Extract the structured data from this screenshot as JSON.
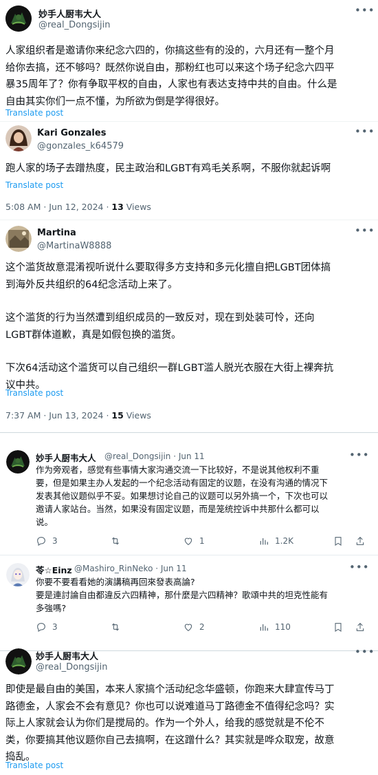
{
  "post1": {
    "name": "妙手人厨韦大人",
    "handle": "@real_Dongsijin",
    "lines": [
      "人家组织者是邀请你来纪念六四的，你搞这些有的没的，六月还有一整个月",
      "给你去搞，还不够吗？既然你说自由，那粉红也可以来这个场子纪念六四平",
      "暴35周年了？你有争取平权的自由，人家也有表达支持中共的自由。什么是",
      "自由其实你们一点不懂，为所欲为倒是学得很好。"
    ],
    "translate": "Translate post"
  },
  "post2": {
    "name": "Kari Gonzales",
    "handle": "@gonzales_k64579",
    "lines": [
      "跑人家的场子去蹭热度，民主政治和LGBT有鸡毛关系啊，不服你就起诉啊"
    ],
    "translate": "Translate post",
    "time": "5:08 AM · Jun 12, 2024 · ",
    "views_count": "13",
    "views_label": " Views"
  },
  "post3": {
    "name": "Martina",
    "handle": "@MartinaW8888",
    "para1": [
      "这个滥货故意混淆视听说什么要取得多方支持和多元化擅自把LGBT团体搞",
      "到海外反共组织的64纪念活动上来了。"
    ],
    "para2": [
      "这个滥货的行为当然遭到组织成员的一致反对，现在到处装可怜，还向",
      "LGBT群体道歉，真是如假包换的滥货。"
    ],
    "para3": [
      "下次64活动这个滥货可以自己组织一群LGBT滥人脱光衣服在大街上裸奔抗",
      "议中共。"
    ],
    "translate": "Translate post",
    "time": "7:37 AM · Jun 13, 2024 · ",
    "views_count": "15",
    "views_label": " Views"
  },
  "reply1": {
    "name": "妙手人厨韦大人",
    "handle_date": "@real_Dongsijin · Jun 11",
    "lines": [
      "作为旁观者，感觉有些事情大家沟通交流一下比较好，不是说其他权利不重",
      "要，但是如果主办人发起的一个纪念活动有固定的议题，在没有沟通的情况下",
      "发表其他议题似乎不妥。如果想讨论自己的议题可以另外搞一个，下次也可以",
      "邀请人家站台。当然，如果没有固定议题，而是笼统控诉中共那什么都可以",
      "说。"
    ],
    "replies": "3",
    "retweets": "",
    "likes": "1",
    "views": "1.2K"
  },
  "reply2": {
    "name": "苓☆Einz",
    "handle_date": "@Mashiro_RinNeko · Jun 11",
    "lines": [
      "你要不要看看她的演講稿再回來發表高論?",
      "要是連討論自由都違反六四精神，那什麼是六四精神？歌頌中共的坦克性能有",
      "多強嗎?"
    ],
    "replies": "3",
    "retweets": "",
    "likes": "2",
    "views": "110"
  },
  "post4": {
    "name": "妙手人厨韦大人",
    "handle": "@real_Dongsijin",
    "lines": [
      "即使是最自由的美国，本来人家搞个活动纪念华盛顿，你跑来大肆宣传马丁",
      "路德金，人家会不会有意见？你也可以说难道马丁路德金不值得纪念吗？实",
      "际上人家就会认为你们是搅局的。作为一个外人，给我的感觉就是不伦不",
      "类，你要搞其他议题你自己去搞啊，在这蹭什么？其实就是哗众取宠，故意",
      "捣乱。"
    ],
    "translate": "Translate post"
  },
  "icons": {
    "more": "more-options-icon",
    "reply": "reply-icon",
    "retweet": "retweet-icon",
    "like": "like-icon",
    "views": "views-icon"
  },
  "colors": {
    "link": "#1d9bf0",
    "secondary": "#536471",
    "text": "#0f1419"
  }
}
